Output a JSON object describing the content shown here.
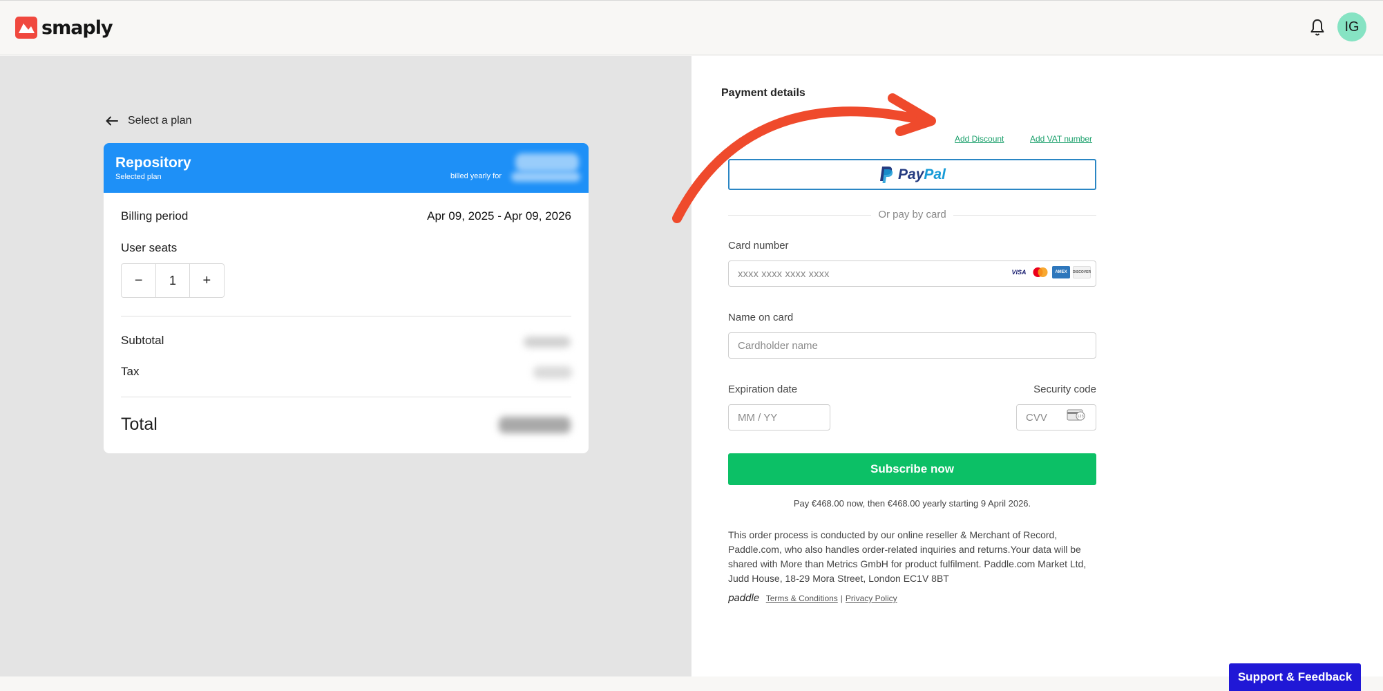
{
  "header": {
    "brand": "smaply",
    "avatar_initials": "IG",
    "icons": [
      "smaply-logo-icon",
      "bell-icon"
    ]
  },
  "plan": {
    "back_label": "Select a plan",
    "name": "Repository",
    "selected_label": "Selected plan",
    "billed_label": "billed yearly for",
    "billing_period_label": "Billing period",
    "billing_period_value": "Apr 09, 2025 - Apr 09, 2026",
    "seats_label": "User seats",
    "seats_value": "1",
    "decrement": "−",
    "increment": "+",
    "subtotal_label": "Subtotal",
    "tax_label": "Tax",
    "total_label": "Total"
  },
  "payment": {
    "title": "Payment details",
    "add_discount": "Add Discount",
    "add_vat": "Add VAT number",
    "paypal_pay": "Pay",
    "paypal_pal": "Pal",
    "or_text": "Or pay by card",
    "card_number_label": "Card number",
    "card_number_placeholder": "xxxx xxxx xxxx xxxx",
    "card_brands": [
      "VISA",
      "mastercard",
      "AMEX",
      "DISCOVER"
    ],
    "name_label": "Name on card",
    "name_placeholder": "Cardholder name",
    "expiry_label": "Expiration date",
    "expiry_placeholder": "MM / YY",
    "cvv_label": "Security code",
    "cvv_placeholder": "CVV",
    "subscribe_label": "Subscribe now",
    "pay_note": "Pay €468.00 now, then €468.00 yearly starting 9 April 2026.",
    "legal": "This order process is conducted by our online reseller & Merchant of Record, Paddle.com, who also handles order-related inquiries and returns.Your data will be shared with More than Metrics GmbH for product fulfilment. Paddle.com Market Ltd, Judd House, 18-29 Mora Street, London EC1V 8BT",
    "paddle_brand": "paddle",
    "terms": "Terms & Conditions",
    "separator": "|",
    "privacy": "Privacy Policy"
  },
  "support_label": "Support & Feedback",
  "colors": {
    "plan_header": "#1e90f7",
    "subscribe": "#0cc066",
    "link_green": "#1aa06b",
    "support": "#2018d6",
    "annotation_arrow": "#ef4a2c",
    "avatar": "#86e3c3"
  }
}
